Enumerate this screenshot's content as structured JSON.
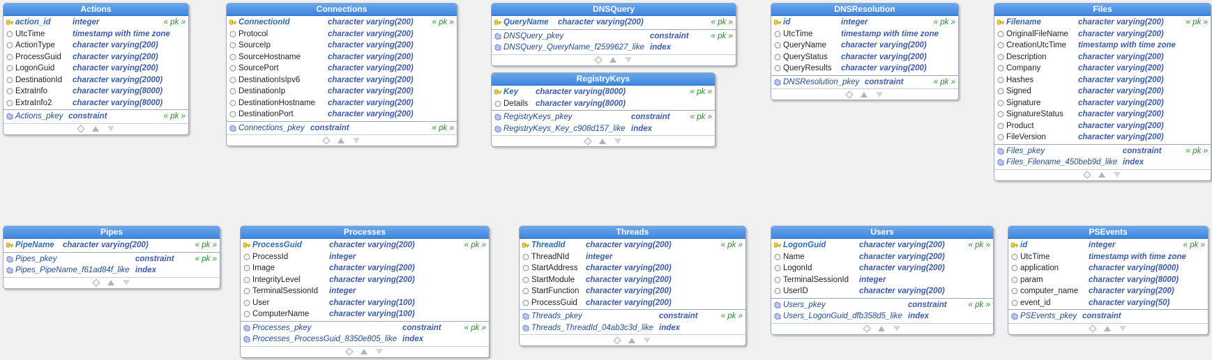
{
  "tables": [
    {
      "id": "actions",
      "title": "Actions",
      "columns": [
        {
          "name": "action_id",
          "type": "integer",
          "pk": true,
          "tag": "« pk »"
        },
        {
          "name": "UtcTime",
          "type": "timestamp with time zone"
        },
        {
          "name": "ActionType",
          "type": "character varying(200)"
        },
        {
          "name": "ProcessGuid",
          "type": "character varying(200)"
        },
        {
          "name": "LogonGuid",
          "type": "character varying(200)"
        },
        {
          "name": "DestinationId",
          "type": "character varying(2000)"
        },
        {
          "name": "ExtraInfo",
          "type": "character varying(8000)"
        },
        {
          "name": "ExtraInfo2",
          "type": "character varying(8000)"
        }
      ],
      "indexes": [
        {
          "name": "Actions_pkey",
          "kind": "constraint",
          "tag": "« pk »"
        }
      ]
    },
    {
      "id": "connections",
      "title": "Connections",
      "columns": [
        {
          "name": "ConnectionId",
          "type": "character varying(200)",
          "pk": true,
          "tag": "« pk »"
        },
        {
          "name": "Protocol",
          "type": "character varying(200)"
        },
        {
          "name": "SourceIp",
          "type": "character varying(200)"
        },
        {
          "name": "SourceHostname",
          "type": "character varying(200)"
        },
        {
          "name": "SourcePort",
          "type": "character varying(200)"
        },
        {
          "name": "DestinationIsIpv6",
          "type": "character varying(200)"
        },
        {
          "name": "DestinationIp",
          "type": "character varying(200)"
        },
        {
          "name": "DestinationHostname",
          "type": "character varying(200)"
        },
        {
          "name": "DestinationPort",
          "type": "character varying(200)"
        }
      ],
      "indexes": [
        {
          "name": "Connections_pkey",
          "kind": "constraint",
          "tag": "« pk »"
        }
      ]
    },
    {
      "id": "dnsquery",
      "title": "DNSQuery",
      "columns": [
        {
          "name": "QueryName",
          "type": "character varying(200)",
          "pk": true,
          "tag": "« pk »"
        }
      ],
      "indexes": [
        {
          "name": "DNSQuery_pkey",
          "kind": "constraint",
          "tag": "« pk »"
        },
        {
          "name": "DNSQuery_QueryName_f2599627_like",
          "kind": "index"
        }
      ]
    },
    {
      "id": "registrykeys",
      "title": "RegistryKeys",
      "columns": [
        {
          "name": "Key",
          "type": "character varying(8000)",
          "pk": true,
          "tag": "« pk »"
        },
        {
          "name": "Details",
          "type": "character varying(8000)"
        }
      ],
      "indexes": [
        {
          "name": "RegistryKeys_pkey",
          "kind": "constraint",
          "tag": "« pk »"
        },
        {
          "name": "RegistryKeys_Key_c908d157_like",
          "kind": "index"
        }
      ]
    },
    {
      "id": "dnsresolution",
      "title": "DNSResolution",
      "columns": [
        {
          "name": "id",
          "type": "integer",
          "pk": true,
          "tag": "« pk »"
        },
        {
          "name": "UtcTime",
          "type": "timestamp with time zone"
        },
        {
          "name": "QueryName",
          "type": "character varying(200)"
        },
        {
          "name": "QueryStatus",
          "type": "character varying(200)"
        },
        {
          "name": "QueryResults",
          "type": "character varying(200)"
        }
      ],
      "indexes": [
        {
          "name": "DNSResolution_pkey",
          "kind": "constraint",
          "tag": "« pk »"
        }
      ]
    },
    {
      "id": "files",
      "title": "Files",
      "columns": [
        {
          "name": "Filename",
          "type": "character varying(200)",
          "pk": true,
          "tag": "« pk »"
        },
        {
          "name": "OriginalFileName",
          "type": "character varying(200)"
        },
        {
          "name": "CreationUtcTime",
          "type": "timestamp with time zone"
        },
        {
          "name": "Description",
          "type": "character varying(200)"
        },
        {
          "name": "Company",
          "type": "character varying(200)"
        },
        {
          "name": "Hashes",
          "type": "character varying(200)"
        },
        {
          "name": "Signed",
          "type": "character varying(200)"
        },
        {
          "name": "Signature",
          "type": "character varying(200)"
        },
        {
          "name": "SignatureStatus",
          "type": "character varying(200)"
        },
        {
          "name": "Product",
          "type": "character varying(200)"
        },
        {
          "name": "FileVersion",
          "type": "character varying(200)"
        }
      ],
      "indexes": [
        {
          "name": "Files_pkey",
          "kind": "constraint",
          "tag": "« pk »"
        },
        {
          "name": "Files_Filename_450beb9d_like",
          "kind": "index"
        }
      ]
    },
    {
      "id": "pipes",
      "title": "Pipes",
      "columns": [
        {
          "name": "PipeName",
          "type": "character varying(200)",
          "pk": true,
          "tag": "« pk »"
        }
      ],
      "indexes": [
        {
          "name": "Pipes_pkey",
          "kind": "constraint",
          "tag": "« pk »"
        },
        {
          "name": "Pipes_PipeName_f61ad84f_like",
          "kind": "index"
        }
      ]
    },
    {
      "id": "processes",
      "title": "Processes",
      "columns": [
        {
          "name": "ProcessGuid",
          "type": "character varying(200)",
          "pk": true,
          "tag": "« pk »"
        },
        {
          "name": "ProcessId",
          "type": "integer"
        },
        {
          "name": "Image",
          "type": "character varying(200)"
        },
        {
          "name": "IntegrityLevel",
          "type": "character varying(200)"
        },
        {
          "name": "TerminalSessionId",
          "type": "integer"
        },
        {
          "name": "User",
          "type": "character varying(100)"
        },
        {
          "name": "ComputerName",
          "type": "character varying(100)"
        }
      ],
      "indexes": [
        {
          "name": "Processes_pkey",
          "kind": "constraint",
          "tag": "« pk »"
        },
        {
          "name": "Processes_ProcessGuid_8350e805_like",
          "kind": "index"
        }
      ]
    },
    {
      "id": "threads",
      "title": "Threads",
      "columns": [
        {
          "name": "ThreadId",
          "type": "character varying(200)",
          "pk": true,
          "tag": "« pk »"
        },
        {
          "name": "ThreadNId",
          "type": "integer"
        },
        {
          "name": "StartAddress",
          "type": "character varying(200)"
        },
        {
          "name": "StartModule",
          "type": "character varying(200)"
        },
        {
          "name": "StartFunction",
          "type": "character varying(200)"
        },
        {
          "name": "ProcessGuid",
          "type": "character varying(200)"
        }
      ],
      "indexes": [
        {
          "name": "Threads_pkey",
          "kind": "constraint",
          "tag": "« pk »"
        },
        {
          "name": "Threads_ThreadId_04ab3c3d_like",
          "kind": "index"
        }
      ]
    },
    {
      "id": "users",
      "title": "Users",
      "columns": [
        {
          "name": "LogonGuid",
          "type": "character varying(200)",
          "pk": true,
          "tag": "« pk »"
        },
        {
          "name": "Name",
          "type": "character varying(200)"
        },
        {
          "name": "LogonId",
          "type": "character varying(200)"
        },
        {
          "name": "TerminalSessionId",
          "type": "integer"
        },
        {
          "name": "UserID",
          "type": "character varying(200)"
        }
      ],
      "indexes": [
        {
          "name": "Users_pkey",
          "kind": "constraint",
          "tag": "« pk »"
        },
        {
          "name": "Users_LogonGuid_dfb358d5_like",
          "kind": "index"
        }
      ]
    },
    {
      "id": "psevents",
      "title": "PSEvents",
      "columns": [
        {
          "name": "id",
          "type": "integer",
          "pk": true,
          "tag": "« pk »"
        },
        {
          "name": "UtcTime",
          "type": "timestamp with time zone"
        },
        {
          "name": "application",
          "type": "character varying(8000)"
        },
        {
          "name": "param",
          "type": "character varying(8000)"
        },
        {
          "name": "computer_name",
          "type": "character varying(200)"
        },
        {
          "name": "event_id",
          "type": "character varying(50)"
        }
      ],
      "indexes": [
        {
          "name": "PSEvents_pkey",
          "kind": "constraint"
        }
      ]
    }
  ],
  "colors": {
    "header": "#4a90e2",
    "pk_name": "#2d6bb5",
    "type": "#3b5bb0",
    "pk_tag": "#2e8b2e",
    "key_icon": "#e8c51c"
  },
  "icons": {
    "pk_column": "key-icon",
    "column": "column-circle-icon",
    "index": "index-icon"
  }
}
